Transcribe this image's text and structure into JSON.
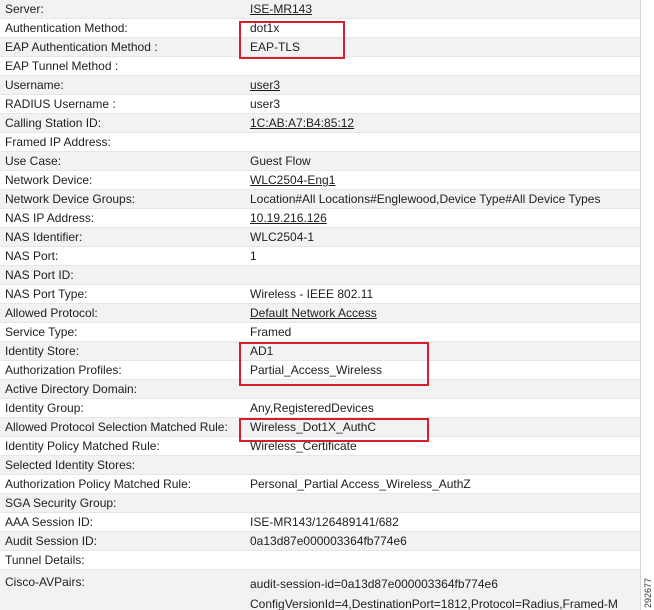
{
  "rows": [
    {
      "label": "Server:",
      "value": "ISE-MR143"
    },
    {
      "label": "Authentication Method:",
      "value": "dot1x"
    },
    {
      "label": "EAP Authentication Method :",
      "value": "EAP-TLS"
    },
    {
      "label": "EAP Tunnel Method :",
      "value": ""
    },
    {
      "label": "Username:",
      "value": "user3"
    },
    {
      "label": "RADIUS Username :",
      "value": "user3"
    },
    {
      "label": "Calling Station ID:",
      "value": "1C:AB:A7:B4:85:12"
    },
    {
      "label": "Framed IP Address:",
      "value": ""
    },
    {
      "label": "Use Case:",
      "value": "Guest Flow"
    },
    {
      "label": "Network Device:",
      "value": "WLC2504-Eng1"
    },
    {
      "label": "Network Device Groups:",
      "value": "Location#All Locations#Englewood,Device Type#All Device Types"
    },
    {
      "label": "NAS IP Address:",
      "value": "10.19.216.126"
    },
    {
      "label": "NAS Identifier:",
      "value": "WLC2504-1"
    },
    {
      "label": "NAS Port:",
      "value": "1"
    },
    {
      "label": "NAS Port ID:",
      "value": ""
    },
    {
      "label": "NAS Port Type:",
      "value": "Wireless - IEEE 802.11"
    },
    {
      "label": "Allowed Protocol:",
      "value": "Default Network Access"
    },
    {
      "label": "Service Type:",
      "value": "Framed"
    },
    {
      "label": "Identity Store:",
      "value": "AD1"
    },
    {
      "label": "Authorization Profiles:",
      "value": "Partial_Access_Wireless"
    },
    {
      "label": "Active Directory Domain:",
      "value": ""
    },
    {
      "label": "Identity Group:",
      "value": "Any,RegisteredDevices"
    },
    {
      "label": "Allowed Protocol Selection Matched Rule:",
      "value": "Wireless_Dot1X_AuthC"
    },
    {
      "label": "Identity Policy Matched Rule:",
      "value": "Wireless_Certificate"
    },
    {
      "label": "Selected Identity Stores:",
      "value": ""
    },
    {
      "label": "Authorization Policy Matched Rule:",
      "value": "Personal_Partial Access_Wireless_AuthZ"
    },
    {
      "label": "SGA Security Group:",
      "value": ""
    },
    {
      "label": "AAA Session ID:",
      "value": "ISE-MR143/126489141/682"
    },
    {
      "label": "Audit Session ID:",
      "value": "0a13d87e000003364fb774e6"
    },
    {
      "label": "Tunnel Details:",
      "value": ""
    },
    {
      "label": "Cisco-AVPairs:",
      "value": "audit-session-id=0a13d87e000003364fb774e6"
    },
    {
      "label": "",
      "value": "ConfigVersionId=4,DestinationPort=1812,Protocol=Radius,Framed-M"
    }
  ],
  "figure_id": "292677",
  "colors": {
    "highlight": "#d4202d",
    "row_alt": "#f2f2f2"
  }
}
